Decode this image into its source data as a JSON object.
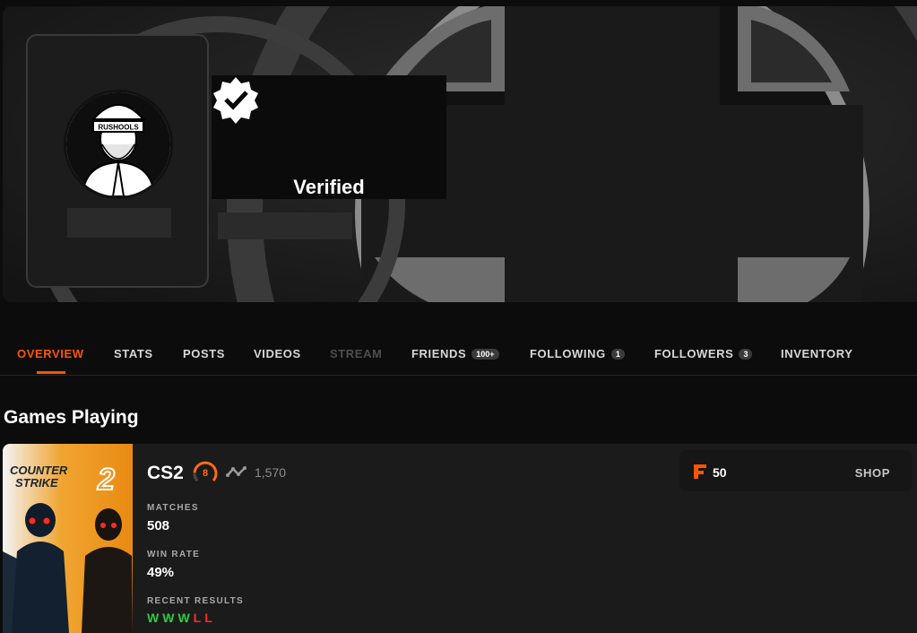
{
  "profile": {
    "verified_label": "Verified",
    "avatar_text": "RUSHOOLS"
  },
  "tabs": [
    {
      "label": "OVERVIEW",
      "state": "active"
    },
    {
      "label": "STATS"
    },
    {
      "label": "POSTS"
    },
    {
      "label": "VIDEOS"
    },
    {
      "label": "STREAM",
      "state": "disabled"
    },
    {
      "label": "FRIENDS",
      "count": "100+"
    },
    {
      "label": "FOLLOWING",
      "count": "1"
    },
    {
      "label": "FOLLOWERS",
      "count": "3"
    },
    {
      "label": "INVENTORY"
    }
  ],
  "games_section": {
    "title": "Games Playing"
  },
  "game": {
    "cover_line1": "COUNTER",
    "cover_line2": "STRIKE",
    "cover_number": "2",
    "name": "CS2",
    "level": "8",
    "elo": "1,570",
    "matches_label": "MATCHES",
    "matches_value": "508",
    "winrate_label": "WIN RATE",
    "winrate_value": "49%",
    "recent_label": "RECENT RESULTS",
    "recent_results": [
      "W",
      "W",
      "W",
      "L",
      "L"
    ],
    "points_value": "50",
    "shop_label": "SHOP"
  },
  "colors": {
    "accent": "#ff5500",
    "win": "#2ecc40",
    "loss": "#ff2a2a"
  },
  "icons": [
    "verified-badge-icon",
    "skill-level-icon",
    "elo-graph-icon",
    "faceit-points-icon"
  ]
}
